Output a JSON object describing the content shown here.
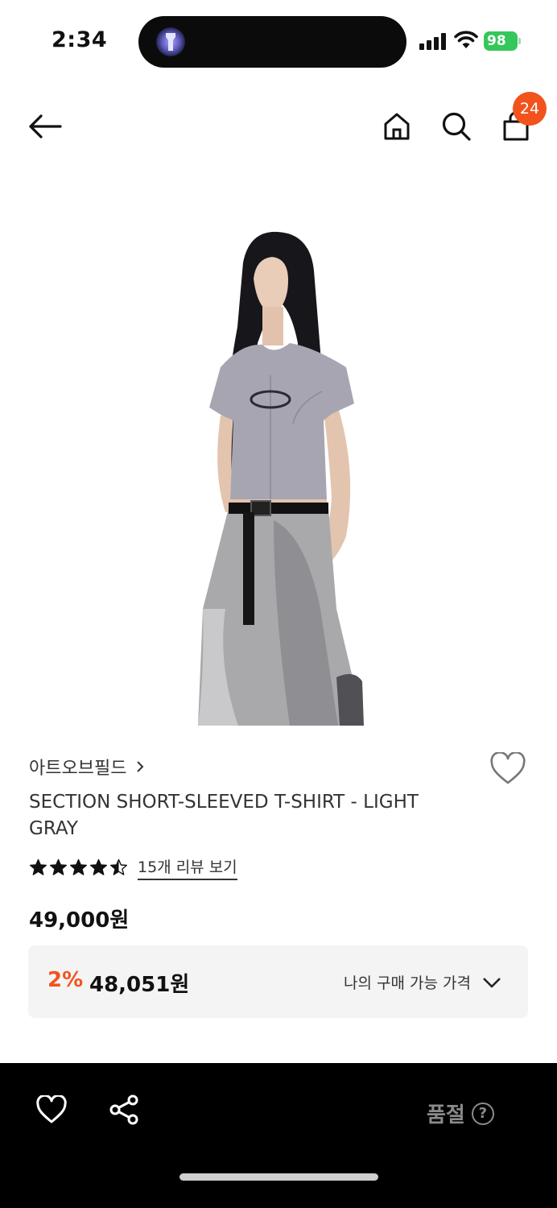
{
  "status_bar": {
    "time": "2:34",
    "battery": "98"
  },
  "nav": {
    "cart_count": "24"
  },
  "product": {
    "brand": "아트오브필드",
    "title": "SECTION SHORT-SLEEVED T-SHIRT - LIGHT GRAY",
    "rating": 4.5,
    "review_link": "15개 리뷰 보기",
    "price": "49,000원",
    "discount_rate": "2%",
    "discount_price": "48,051원",
    "my_price_label": "나의 구매 가능 가격"
  },
  "bottom_bar": {
    "soldout_label": "품절",
    "help_symbol": "?"
  },
  "colors": {
    "accent": "#f2531d",
    "battery": "#34c759",
    "bottom_bar": "#000000"
  }
}
